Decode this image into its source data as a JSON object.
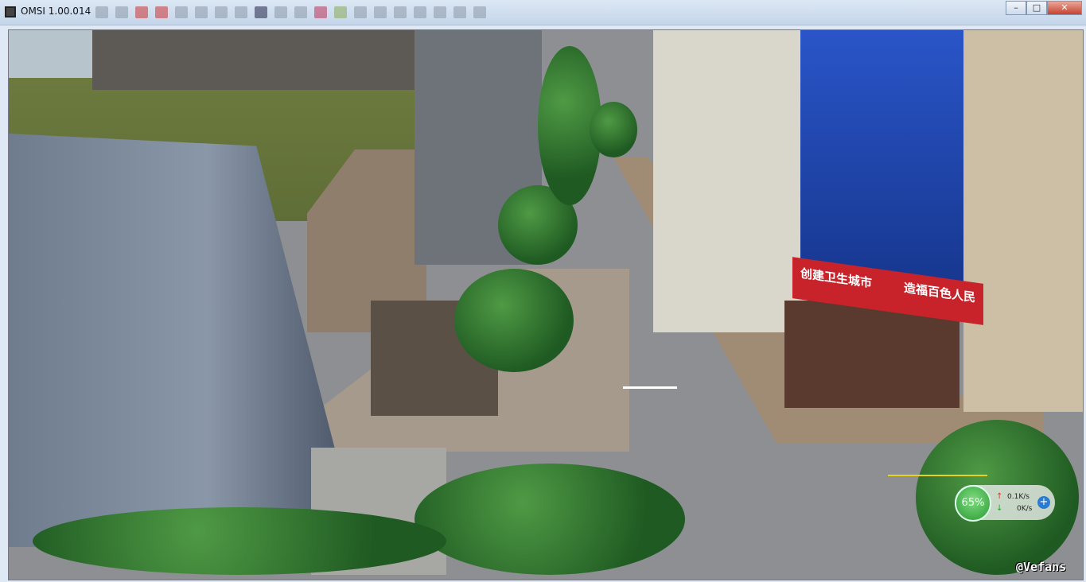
{
  "window": {
    "title": "OMSI 1.00.014",
    "controls": {
      "minimize": "–",
      "maximize": "□",
      "close": "✕"
    }
  },
  "scene": {
    "billboard": {
      "left_text": "创建卫生城市",
      "right_text": "造福百色人民"
    }
  },
  "network_widget": {
    "memory_percent": "65%",
    "upload": "0.1K/s",
    "download": "0K/s",
    "up_icon": "↑",
    "down_icon": "↓",
    "plus": "+"
  },
  "watermark": "@Vefans",
  "colors": {
    "titlebar": "#c5d6ea",
    "road": "#8d8f92",
    "glass": "#1d46b8",
    "sign": "#c8232b"
  }
}
